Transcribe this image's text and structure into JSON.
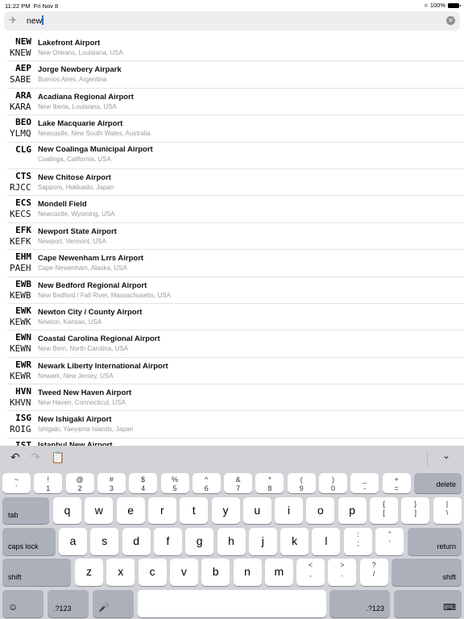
{
  "status": {
    "time": "11:22 PM",
    "date": "Fri Nov 8",
    "battery": "100%"
  },
  "search": {
    "value": "new",
    "icon": "airplane-icon"
  },
  "airports": [
    {
      "iata": "NEW",
      "icao": "KNEW",
      "name": "Lakefront Airport",
      "location": "New Orleans, Louisiana, USA"
    },
    {
      "iata": "AEP",
      "icao": "SABE",
      "name": "Jorge Newbery Airpark",
      "location": "Buenos Aires, Argentina"
    },
    {
      "iata": "ARA",
      "icao": "KARA",
      "name": "Acadiana Regional Airport",
      "location": "New Iberia, Louisiana, USA"
    },
    {
      "iata": "BEO",
      "icao": "YLMQ",
      "name": "Lake Macquarie Airport",
      "location": "Newcastle, New South Wales, Australia"
    },
    {
      "iata": "CLG",
      "icao": "",
      "name": "New Coalinga Municipal Airport",
      "location": "Coalinga, California, USA"
    },
    {
      "iata": "CTS",
      "icao": "RJCC",
      "name": "New Chitose Airport",
      "location": "Sapporo, Hokkaido, Japan"
    },
    {
      "iata": "ECS",
      "icao": "KECS",
      "name": "Mondell Field",
      "location": "Newcastle, Wyoming, USA"
    },
    {
      "iata": "EFK",
      "icao": "KEFK",
      "name": "Newport State Airport",
      "location": "Newport, Vermont, USA"
    },
    {
      "iata": "EHM",
      "icao": "PAEH",
      "name": "Cape Newenham Lrrs Airport",
      "location": "Cape Newenham, Alaska, USA"
    },
    {
      "iata": "EWB",
      "icao": "KEWB",
      "name": "New Bedford Regional Airport",
      "location": "New Bedford / Fall River, Massachusetts, USA"
    },
    {
      "iata": "EWK",
      "icao": "KEWK",
      "name": "Newton City / County Airport",
      "location": "Newton, Kansas, USA"
    },
    {
      "iata": "EWN",
      "icao": "KEWN",
      "name": "Coastal Carolina Regional Airport",
      "location": "New Bern, North Carolina, USA"
    },
    {
      "iata": "EWR",
      "icao": "KEWR",
      "name": "Newark Liberty International Airport",
      "location": "Newark, New Jersey, USA"
    },
    {
      "iata": "HVN",
      "icao": "KHVN",
      "name": "Tweed New Haven Airport",
      "location": "New Haven, Connecticut, USA"
    },
    {
      "iata": "ISG",
      "icao": "ROIG",
      "name": "New Ishigaki Airport",
      "location": "Ishigaki, Yaeyama Islands, Japan"
    },
    {
      "iata": "IST",
      "icao": "",
      "name": "Istanbul New Airport",
      "location": ""
    }
  ],
  "keyboard": {
    "number_row": [
      [
        "~",
        "`"
      ],
      [
        "!",
        "1"
      ],
      [
        "@",
        "2"
      ],
      [
        "#",
        "3"
      ],
      [
        "$",
        "4"
      ],
      [
        "%",
        "5"
      ],
      [
        "^",
        "6"
      ],
      [
        "&",
        "7"
      ],
      [
        "*",
        "8"
      ],
      [
        "(",
        "9"
      ],
      [
        ")",
        "0"
      ],
      [
        "_",
        "-"
      ],
      [
        "+",
        "="
      ]
    ],
    "delete": "delete",
    "tab": "tab",
    "caps": "caps lock",
    "return": "return",
    "shift": "shift",
    "numbers": ".?123",
    "q_row": [
      "q",
      "w",
      "e",
      "r",
      "t",
      "y",
      "u",
      "i",
      "o",
      "p"
    ],
    "q_row_sym": [
      [
        "{",
        "["
      ],
      [
        "}",
        "]"
      ],
      [
        "|",
        "\\"
      ]
    ],
    "a_row": [
      "a",
      "s",
      "d",
      "f",
      "g",
      "h",
      "j",
      "k",
      "l"
    ],
    "a_row_sym": [
      [
        ":",
        ";"
      ],
      [
        "\"",
        "'"
      ]
    ],
    "z_row": [
      "z",
      "x",
      "c",
      "v",
      "b",
      "n",
      "m"
    ],
    "z_row_sym": [
      [
        "<",
        ","
      ],
      [
        ">",
        "."
      ],
      [
        "?",
        "/"
      ]
    ]
  }
}
